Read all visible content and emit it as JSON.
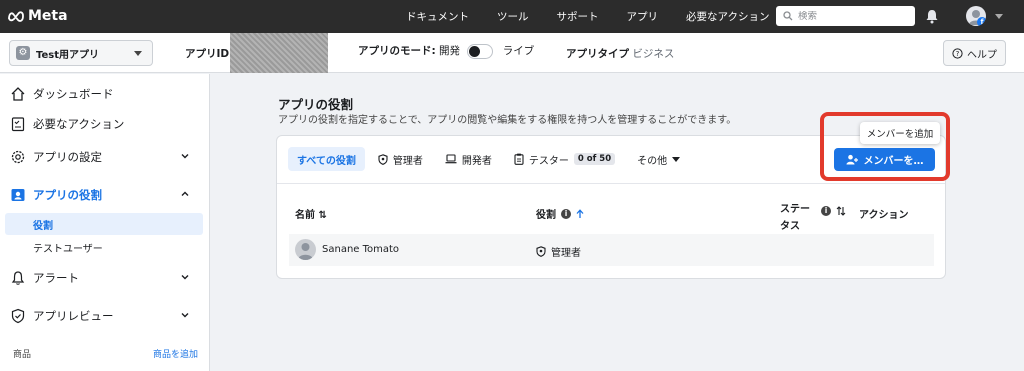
{
  "topbar": {
    "logo": "Meta",
    "nav": [
      "ドキュメント",
      "ツール",
      "サポート",
      "アプリ",
      "必要なアクション"
    ],
    "search_placeholder": "検索",
    "avatar_badge": "f"
  },
  "subbar": {
    "app_name": "Test用アプリ",
    "app_id_label": "アプリID:",
    "mode_label": "アプリのモード:",
    "mode_dev": "開発",
    "mode_live": "ライブ",
    "type_label": "アプリタイプ",
    "type_value": "ビジネス",
    "help": "ヘルプ"
  },
  "sidebar": {
    "items": [
      {
        "label": "ダッシュボード",
        "icon": "home-icon"
      },
      {
        "label": "必要なアクション",
        "icon": "checklist-icon"
      },
      {
        "label": "アプリの設定",
        "icon": "gear-icon"
      },
      {
        "label": "アプリの役割",
        "icon": "roles-icon"
      },
      {
        "label": "アラート",
        "icon": "bell-icon"
      },
      {
        "label": "アプリレビュー",
        "icon": "shield-check-icon"
      }
    ],
    "sub_items": [
      "役割",
      "テストユーザー"
    ],
    "footer_left": "商品",
    "footer_right": "商品を追加"
  },
  "main": {
    "title": "アプリの役割",
    "description": "アプリの役割を指定することで、アプリの閲覧や編集をする権限を持つ人を管理することができます。",
    "tabs": [
      {
        "label": "すべての役割",
        "icon": ""
      },
      {
        "label": "管理者",
        "icon": "shield-icon"
      },
      {
        "label": "開発者",
        "icon": "laptop-icon"
      },
      {
        "label": "テスター",
        "icon": "clipboard-icon",
        "badge": "0 of 50"
      },
      {
        "label": "その他",
        "icon": ""
      }
    ],
    "add_button": "メンバーを…",
    "tooltip": "メンバーを追加",
    "columns": {
      "name": "名前 ⇅",
      "role": "役割",
      "status_line1": "ステー",
      "status_line2": "タス",
      "action": "アクション"
    },
    "rows": [
      {
        "name": "Sanane Tomato",
        "role": "管理者"
      }
    ]
  },
  "colors": {
    "accent": "#1b74e4",
    "highlight": "#e23a2c",
    "topbar": "#2c2c2c"
  }
}
